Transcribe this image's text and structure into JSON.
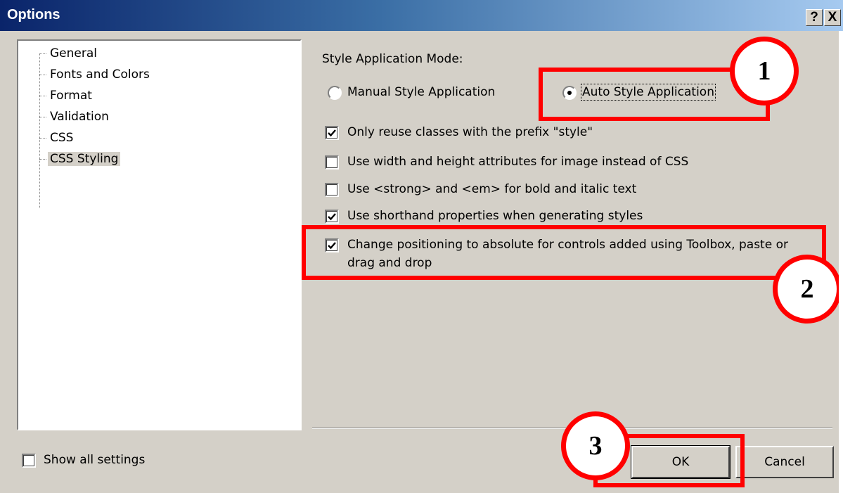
{
  "window": {
    "title": "Options",
    "help_button": "?",
    "close_button": "X"
  },
  "tree": {
    "items": [
      {
        "label": "General"
      },
      {
        "label": "Fonts and Colors"
      },
      {
        "label": "Format"
      },
      {
        "label": "Validation"
      },
      {
        "label": "CSS"
      },
      {
        "label": "CSS Styling",
        "selected": true
      }
    ]
  },
  "panel": {
    "mode_label": "Style Application Mode:",
    "radio_manual": {
      "label": "Manual Style Application",
      "checked": false
    },
    "radio_auto": {
      "label": "Auto Style Application",
      "checked": true
    },
    "checkboxes": [
      {
        "label": "Only reuse classes with the prefix \"style\"",
        "checked": true
      },
      {
        "label": "Use width and height attributes for image instead of CSS",
        "checked": false
      },
      {
        "label": "Use <strong> and <em> for bold and italic text",
        "checked": false
      },
      {
        "label": "Use shorthand properties when generating styles",
        "checked": true
      },
      {
        "label_line1": "Change positioning to absolute for controls added using Toolbox, paste or",
        "label_line2": "drag and drop",
        "checked": true
      }
    ]
  },
  "footer": {
    "show_all_settings": {
      "label": "Show all settings",
      "checked": false
    },
    "ok_label": "OK",
    "cancel_label": "Cancel"
  },
  "callouts": [
    "1",
    "2",
    "3"
  ],
  "colors": {
    "dialog_bg": "#d4d0c8",
    "title_start": "#0a246a",
    "title_end": "#a6caf0",
    "highlight": "#ff0000"
  }
}
